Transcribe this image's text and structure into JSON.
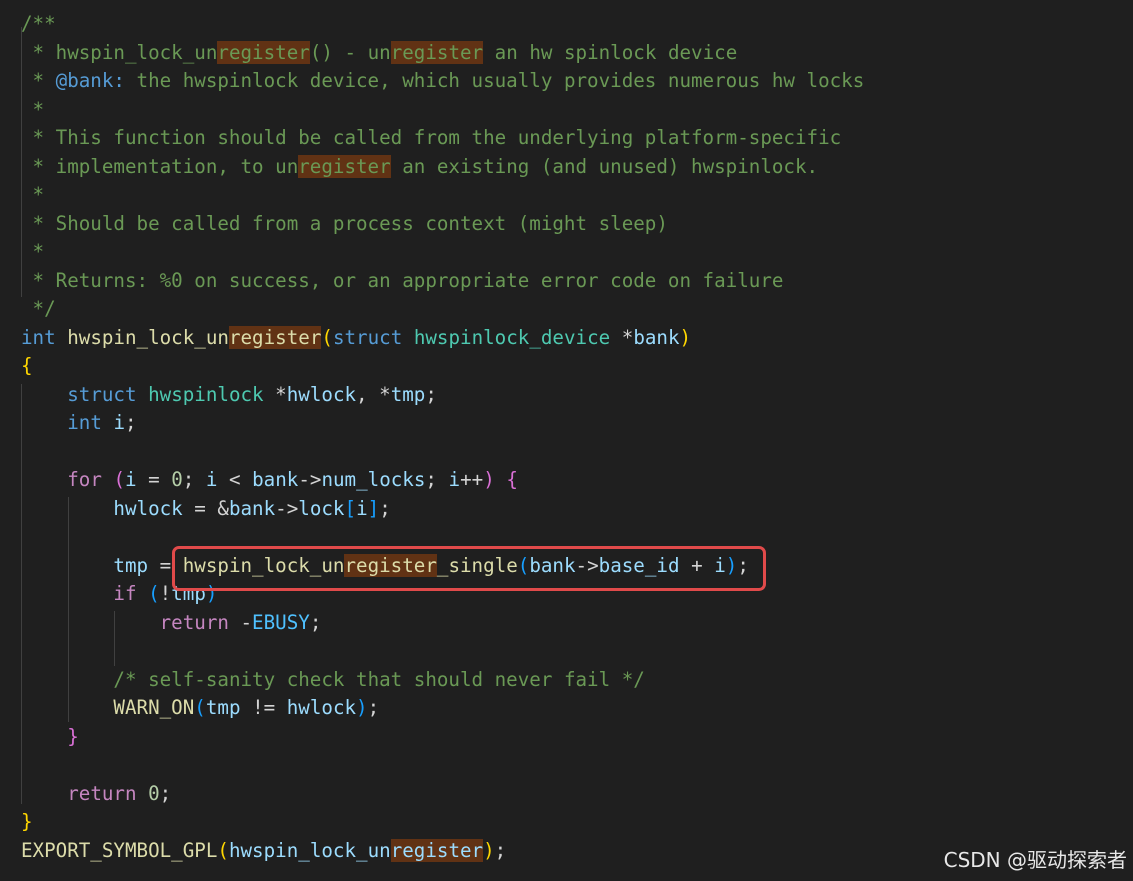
{
  "watermark": "CSDN @驱动探索者",
  "colors": {
    "background": "#1f1f1f",
    "comment": "#6a9955",
    "keyword": "#569cd6",
    "control": "#c586c0",
    "type": "#4ec9b0",
    "function": "#dcdcaa",
    "variable": "#9cdcfe",
    "number": "#b5cea8",
    "search_highlight": "#613214",
    "annotation_box": "#e04a4a"
  },
  "code_lines": [
    [
      [
        "c-comment",
        "/**"
      ]
    ],
    [
      [
        "c-comment",
        " * hwspin_lock_un"
      ],
      [
        "c-comment hl",
        "register"
      ],
      [
        "c-comment",
        "() - un"
      ],
      [
        "c-comment hl",
        "register"
      ],
      [
        "c-comment",
        " an hw spinlock device"
      ]
    ],
    [
      [
        "c-comment",
        " * "
      ],
      [
        "c-doctag",
        "@bank:"
      ],
      [
        "c-comment",
        " the hwspinlock device, which usually provides numerous hw locks"
      ]
    ],
    [
      [
        "c-comment",
        " *"
      ]
    ],
    [
      [
        "c-comment",
        " * This function should be called from the underlying platform-specific"
      ]
    ],
    [
      [
        "c-comment",
        " * implementation, to un"
      ],
      [
        "c-comment hl",
        "register"
      ],
      [
        "c-comment",
        " an existing (and unused) hwspinlock."
      ]
    ],
    [
      [
        "c-comment",
        " *"
      ]
    ],
    [
      [
        "c-comment",
        " * Should be called from a process context (might sleep)"
      ]
    ],
    [
      [
        "c-comment",
        " *"
      ]
    ],
    [
      [
        "c-comment",
        " * Returns: %0 on success, or an appropriate error code on failure"
      ]
    ],
    [
      [
        "c-comment",
        " */"
      ]
    ],
    [
      [
        "c-kw",
        "int"
      ],
      [
        "c-punc",
        " "
      ],
      [
        "c-func",
        "hwspin_lock_un"
      ],
      [
        "c-func hl",
        "register"
      ],
      [
        "c-brace1",
        "("
      ],
      [
        "c-kw",
        "struct"
      ],
      [
        "c-punc",
        " "
      ],
      [
        "c-type",
        "hwspinlock_device"
      ],
      [
        "c-punc",
        " *"
      ],
      [
        "c-var",
        "bank"
      ],
      [
        "c-brace1",
        ")"
      ]
    ],
    [
      [
        "c-brace1",
        "{"
      ]
    ],
    [
      [
        "c-punc",
        "    "
      ],
      [
        "c-kw",
        "struct"
      ],
      [
        "c-punc",
        " "
      ],
      [
        "c-type",
        "hwspinlock"
      ],
      [
        "c-punc",
        " *"
      ],
      [
        "c-var",
        "hwlock"
      ],
      [
        "c-punc",
        ", *"
      ],
      [
        "c-var",
        "tmp"
      ],
      [
        "c-punc",
        ";"
      ]
    ],
    [
      [
        "c-punc",
        "    "
      ],
      [
        "c-kw",
        "int"
      ],
      [
        "c-punc",
        " "
      ],
      [
        "c-var",
        "i"
      ],
      [
        "c-punc",
        ";"
      ]
    ],
    [],
    [
      [
        "c-punc",
        "    "
      ],
      [
        "c-ctrl",
        "for"
      ],
      [
        "c-punc",
        " "
      ],
      [
        "c-brace2",
        "("
      ],
      [
        "c-var",
        "i"
      ],
      [
        "c-punc",
        " = "
      ],
      [
        "c-num",
        "0"
      ],
      [
        "c-punc",
        "; "
      ],
      [
        "c-var",
        "i"
      ],
      [
        "c-punc",
        " < "
      ],
      [
        "c-var",
        "bank"
      ],
      [
        "c-punc",
        "->"
      ],
      [
        "c-var",
        "num_locks"
      ],
      [
        "c-punc",
        "; "
      ],
      [
        "c-var",
        "i"
      ],
      [
        "c-punc",
        "++"
      ],
      [
        "c-brace2",
        ")"
      ],
      [
        "c-punc",
        " "
      ],
      [
        "c-brace2",
        "{"
      ]
    ],
    [
      [
        "c-punc",
        "        "
      ],
      [
        "c-var",
        "hwlock"
      ],
      [
        "c-punc",
        " = &"
      ],
      [
        "c-var",
        "bank"
      ],
      [
        "c-punc",
        "->"
      ],
      [
        "c-var",
        "lock"
      ],
      [
        "c-brace3",
        "["
      ],
      [
        "c-var",
        "i"
      ],
      [
        "c-brace3",
        "]"
      ],
      [
        "c-punc",
        ";"
      ]
    ],
    [],
    [
      [
        "c-punc",
        "        "
      ],
      [
        "c-var",
        "tmp"
      ],
      [
        "c-punc",
        " = "
      ],
      [
        "c-func",
        "hwspin_lock_un"
      ],
      [
        "c-func hl",
        "register"
      ],
      [
        "c-func",
        "_single"
      ],
      [
        "c-brace3",
        "("
      ],
      [
        "c-var",
        "bank"
      ],
      [
        "c-punc",
        "->"
      ],
      [
        "c-var",
        "base_id"
      ],
      [
        "c-punc",
        " + "
      ],
      [
        "c-var",
        "i"
      ],
      [
        "c-brace3",
        ")"
      ],
      [
        "c-punc",
        ";"
      ]
    ],
    [
      [
        "c-punc",
        "        "
      ],
      [
        "c-ctrl",
        "if"
      ],
      [
        "c-punc",
        " "
      ],
      [
        "c-brace3",
        "("
      ],
      [
        "c-punc",
        "!"
      ],
      [
        "c-var",
        "tmp"
      ],
      [
        "c-brace3",
        ")"
      ]
    ],
    [
      [
        "c-punc",
        "            "
      ],
      [
        "c-ctrl",
        "return"
      ],
      [
        "c-punc",
        " -"
      ],
      [
        "c-const",
        "EBUSY"
      ],
      [
        "c-punc",
        ";"
      ]
    ],
    [],
    [
      [
        "c-punc",
        "        "
      ],
      [
        "c-comment",
        "/* self-sanity check that should never fail */"
      ]
    ],
    [
      [
        "c-punc",
        "        "
      ],
      [
        "c-func",
        "WARN_ON"
      ],
      [
        "c-brace3",
        "("
      ],
      [
        "c-var",
        "tmp"
      ],
      [
        "c-punc",
        " != "
      ],
      [
        "c-var",
        "hwlock"
      ],
      [
        "c-brace3",
        ")"
      ],
      [
        "c-punc",
        ";"
      ]
    ],
    [
      [
        "c-punc",
        "    "
      ],
      [
        "c-brace2",
        "}"
      ]
    ],
    [],
    [
      [
        "c-punc",
        "    "
      ],
      [
        "c-ctrl",
        "return"
      ],
      [
        "c-punc",
        " "
      ],
      [
        "c-num",
        "0"
      ],
      [
        "c-punc",
        ";"
      ]
    ],
    [
      [
        "c-brace1",
        "}"
      ]
    ],
    [
      [
        "c-func",
        "EXPORT_SYMBOL_GPL"
      ],
      [
        "c-brace1",
        "("
      ],
      [
        "c-var",
        "hwspin_lock_un"
      ],
      [
        "c-var hl",
        "register"
      ],
      [
        "c-brace1",
        ")"
      ],
      [
        "c-punc",
        ";"
      ]
    ]
  ]
}
